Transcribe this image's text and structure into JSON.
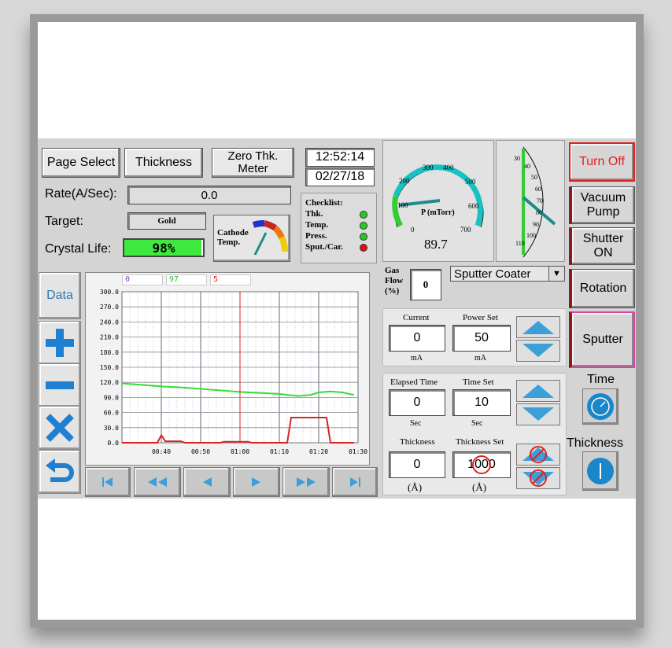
{
  "top_buttons": {
    "page_select": "Page Select",
    "thickness": "Thickness",
    "zero_thk": "Zero Thk. Meter"
  },
  "clock": {
    "time": "12:52:14",
    "date": "02/27/18"
  },
  "rate": {
    "label": "Rate(A/Sec):",
    "value": "0.0"
  },
  "target": {
    "label": "Target:",
    "value": "Gold"
  },
  "crystal_life": {
    "label": "Crystal Life:",
    "value": "98%",
    "fraction": 0.98
  },
  "cathode": {
    "label": "Cathode Temp."
  },
  "checklist": {
    "title": "Checklist:",
    "items": [
      {
        "label": "Thk.",
        "status": "#22cc22"
      },
      {
        "label": "Temp.",
        "status": "#22cc22"
      },
      {
        "label": "Press.",
        "status": "#22cc22"
      },
      {
        "label": "Sput./Car.",
        "status": "#dd1111"
      }
    ]
  },
  "pressure_gauge": {
    "unit": "P (mTorr)",
    "value": "89.7",
    "ticks": [
      "100",
      "200",
      "300",
      "400",
      "500",
      "600",
      "700",
      "0"
    ]
  },
  "vertical_gauge": {
    "ticks": [
      "30",
      "40",
      "50",
      "60",
      "70",
      "80",
      "90",
      "100",
      "110"
    ]
  },
  "gas_flow": {
    "label": "Gas Flow (%)",
    "value": "0"
  },
  "mode_select": {
    "value": "Sputter Coater"
  },
  "current": {
    "label": "Current",
    "value": "0",
    "unit": "mA"
  },
  "power_set": {
    "label": "Power Set",
    "value": "50",
    "unit": "mA"
  },
  "elapsed_time": {
    "label": "Elapsed Time",
    "value": "0",
    "unit": "Sec"
  },
  "time_set": {
    "label": "Time Set",
    "value": "10",
    "unit": "Sec"
  },
  "thickness_read": {
    "label": "Thickness",
    "value": "0",
    "unit": "(Å)"
  },
  "thickness_set": {
    "label": "Thickness Set",
    "value": "1000",
    "unit": "(Å)"
  },
  "right_buttons": {
    "turn_off": "Turn Off",
    "vacuum_pump": "Vacuum Pump",
    "shutter_on": "Shutter ON",
    "rotation": "Rotation",
    "sputter": "Sputter",
    "time": "Time",
    "thickness": "Thickness"
  },
  "side_buttons": {
    "data": "Data"
  },
  "chart_data": {
    "type": "line",
    "legend_values": [
      "0",
      "97",
      "5"
    ],
    "legend_colors": [
      "#8a3ad0",
      "#33dd33",
      "#dd2222"
    ],
    "y_ticks": [
      "300.0",
      "270.0",
      "240.0",
      "210.0",
      "180.0",
      "150.0",
      "120.0",
      "90.0",
      "60.0",
      "30.0",
      "0.0"
    ],
    "x_ticks": [
      "00:40",
      "00:50",
      "01:00",
      "01:10",
      "01:20",
      "01:30"
    ],
    "ylim": [
      0,
      300
    ],
    "xlim": [
      30,
      90
    ],
    "cursor_x": 60,
    "series": [
      {
        "color": "#33dd33",
        "points": [
          [
            30,
            118
          ],
          [
            35,
            115
          ],
          [
            40,
            112
          ],
          [
            45,
            110
          ],
          [
            50,
            107
          ],
          [
            55,
            104
          ],
          [
            60,
            101
          ],
          [
            65,
            99
          ],
          [
            70,
            97
          ],
          [
            72,
            95
          ],
          [
            75,
            93
          ],
          [
            78,
            95
          ],
          [
            80,
            100
          ],
          [
            83,
            102
          ],
          [
            86,
            100
          ],
          [
            89,
            95
          ]
        ]
      },
      {
        "color": "#dd2222",
        "points": [
          [
            30,
            0
          ],
          [
            39,
            0
          ],
          [
            40,
            15
          ],
          [
            41,
            3
          ],
          [
            45,
            3
          ],
          [
            46,
            0
          ],
          [
            55,
            0
          ],
          [
            56,
            2
          ],
          [
            62,
            2
          ],
          [
            63,
            0
          ],
          [
            72,
            0
          ],
          [
            73,
            50
          ],
          [
            82,
            50
          ],
          [
            83,
            0
          ],
          [
            89,
            0
          ]
        ]
      }
    ]
  }
}
